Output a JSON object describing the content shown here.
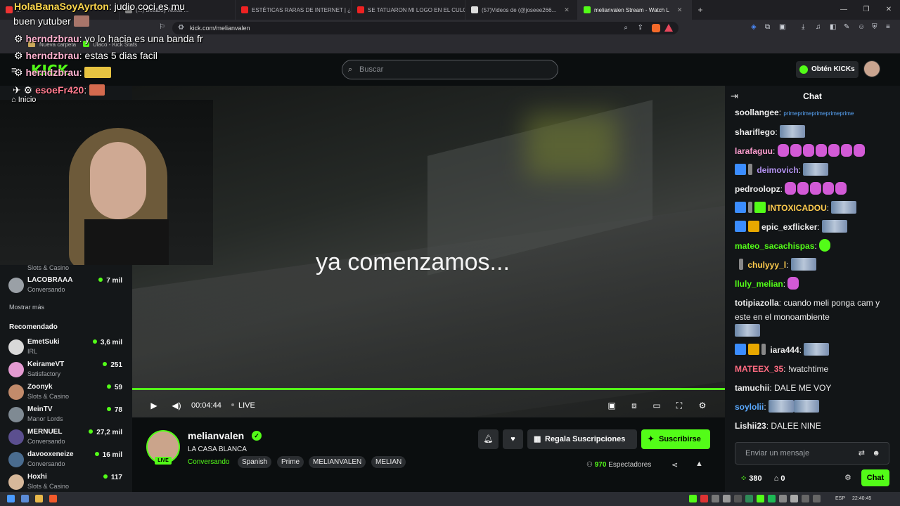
{
  "browser": {
    "tabs": [
      {
        "label": "...",
        "color": "#e33"
      },
      {
        "label": "(...) Beatboy Nokia ...",
        "color": "#888"
      },
      {
        "label": "ESTÉTICAS RARAS DE INTERNET | ¿C",
        "color": "#f00"
      },
      {
        "label": "SE TATUARON MI LOGO EN EL CULO",
        "color": "#f00"
      },
      {
        "label": "(57)Videos de (@joseee266...",
        "color": "#ddd"
      },
      {
        "label": "melianvalen Stream - Watch L",
        "color": "#53fc18"
      }
    ],
    "url": "kick.com/melianvalen",
    "bookmarks": [
      "Nueva carpeta",
      "Ulaco - Kick Stats"
    ]
  },
  "header": {
    "search_placeholder": "Buscar",
    "kicks_button": "Obtén KICKs"
  },
  "overlay_chat": [
    {
      "user": "HolaBanaSoyAyrton",
      "text": "judio coci es mu"
    },
    {
      "user": "",
      "text": "buen yutuber"
    },
    {
      "user": "herndzbrau",
      "text": "yo lo hacia es una banda fr"
    },
    {
      "user": "herndzbrau",
      "text": "estas 5 dias facil"
    },
    {
      "user": "herndzbrau",
      "text": ""
    },
    {
      "user": "esoeFr420",
      "text": ""
    },
    {
      "user": "",
      "text": "Inicio"
    }
  ],
  "sidebar": {
    "top_category": "Slots & Casino",
    "channels": [
      {
        "name": "LACOBRAAA",
        "category": "Conversando",
        "viewers": "7 mil",
        "color": "#9aa0a6"
      }
    ],
    "show_more": "Mostrar más",
    "recommended_title": "Recomendado",
    "recommended": [
      {
        "name": "EmetSuki",
        "category": "IRL",
        "viewers": "3,6 mil",
        "color": "#d9d9d9"
      },
      {
        "name": "KeirameVT",
        "category": "Satisfactory",
        "viewers": "251",
        "color": "#e49ad1"
      },
      {
        "name": "Zoonyk",
        "category": "Slots & Casino",
        "viewers": "59",
        "color": "#c28b6b"
      },
      {
        "name": "MeinTV",
        "category": "Manor Lords",
        "viewers": "78",
        "color": "#7f8a93"
      },
      {
        "name": "MERNUEL",
        "category": "Conversando",
        "viewers": "27,2 mil",
        "color": "#5b4f8f"
      },
      {
        "name": "davooxeneize",
        "category": "Conversando",
        "viewers": "16 mil",
        "color": "#4a6c8f"
      },
      {
        "name": "Hoxhi",
        "category": "Slots & Casino",
        "viewers": "117",
        "color": "#d7b89a"
      }
    ]
  },
  "video": {
    "overlay_text": "ya comenzamos...",
    "time": "00:04:44",
    "live_label": "LIVE"
  },
  "stream": {
    "name": "melianvalen",
    "title": "LA CASA BLANCA",
    "category": "Conversando",
    "tags": [
      "Spanish",
      "Prime",
      "MELIANVALEN",
      "MELIAN"
    ],
    "live_badge": "LIVE",
    "gift_button": "Regala Suscripciones",
    "subscribe_button": "Suscribirse",
    "viewers_count": "970",
    "viewers_label": "Espectadores"
  },
  "chat": {
    "title": "Chat",
    "messages": [
      {
        "user": "soollangee",
        "color": "#f5f5f5",
        "text": "primeprimeprimeprimeprime"
      },
      {
        "user": "shariflego",
        "color": "#f5f5f5",
        "text": ""
      },
      {
        "user": "larafaguu",
        "color": "#ff9ed0",
        "text": ""
      },
      {
        "user": "deimovich",
        "color": "#b392f0",
        "text": ""
      },
      {
        "user": "pedroolopz",
        "color": "#f5f5f5",
        "text": ""
      },
      {
        "user": "INTOXICADOU",
        "color": "#ffcc4d",
        "text": ""
      },
      {
        "user": "epic_exflicker",
        "color": "#f5f5f5",
        "text": ""
      },
      {
        "user": "mateo_sacachispas",
        "color": "#53fc18",
        "text": ""
      },
      {
        "user": "chulyyy_l",
        "color": "#ffcc4d",
        "text": ""
      },
      {
        "user": "lluly_melian",
        "color": "#53fc18",
        "text": ""
      },
      {
        "user": "totipiazolla",
        "color": "#f5f5f5",
        "text": "cuando meli ponga cam y este en el monoambiente"
      },
      {
        "user": "iara444",
        "color": "#f5f5f5",
        "text": ""
      },
      {
        "user": "MATEEX_35",
        "color": "#ff6b81",
        "text": "!watchtime"
      },
      {
        "user": "tamuchii",
        "color": "#f5f5f5",
        "text": "DALE ME VOY"
      },
      {
        "user": "soylolii",
        "color": "#5aa9ff",
        "text": ""
      },
      {
        "user": "Lishii23",
        "color": "#f5f5f5",
        "text": "DALEE NINE"
      }
    ],
    "input_placeholder": "Enviar un mensaje",
    "coins": "380",
    "points": "0",
    "send_button": "Chat"
  },
  "taskbar": {
    "lang": "ESP",
    "clock": "22:40:45"
  }
}
